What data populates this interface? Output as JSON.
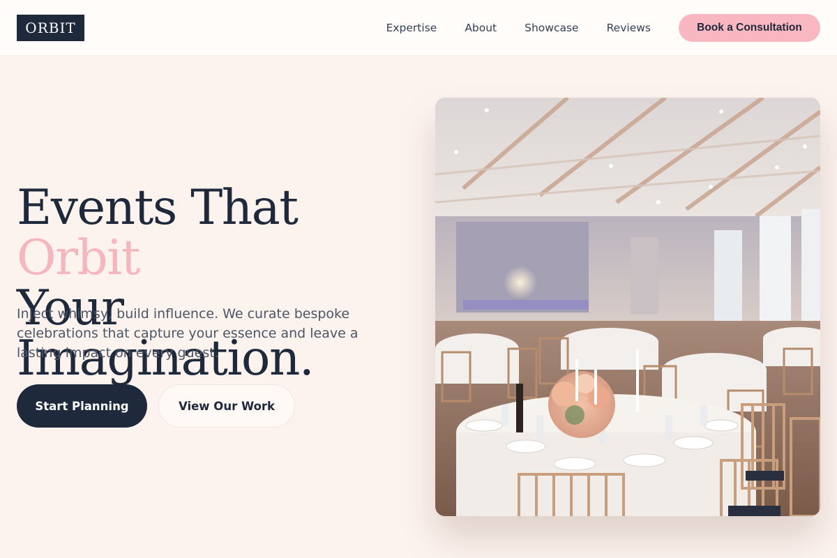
{
  "header": {
    "logo": "ORBIT",
    "nav": [
      "Expertise",
      "About",
      "Showcase",
      "Reviews"
    ],
    "cta_label": "Book a Consultation"
  },
  "hero": {
    "title_line1_start": "Events That ",
    "title_accent": "Orbit",
    "title_line2": "Your Imagination.",
    "subtitle": "Inject whimsy, build influence. We curate bespoke celebrations that capture your essence and leave a lasting impact on every guest.",
    "primary_button": "Start Planning",
    "secondary_button": "View Our Work"
  },
  "colors": {
    "background": "#fdf3ee",
    "navy": "#1e293b",
    "accent_pink": "#f6b6c0",
    "cta_pink": "#f9b8c1"
  }
}
